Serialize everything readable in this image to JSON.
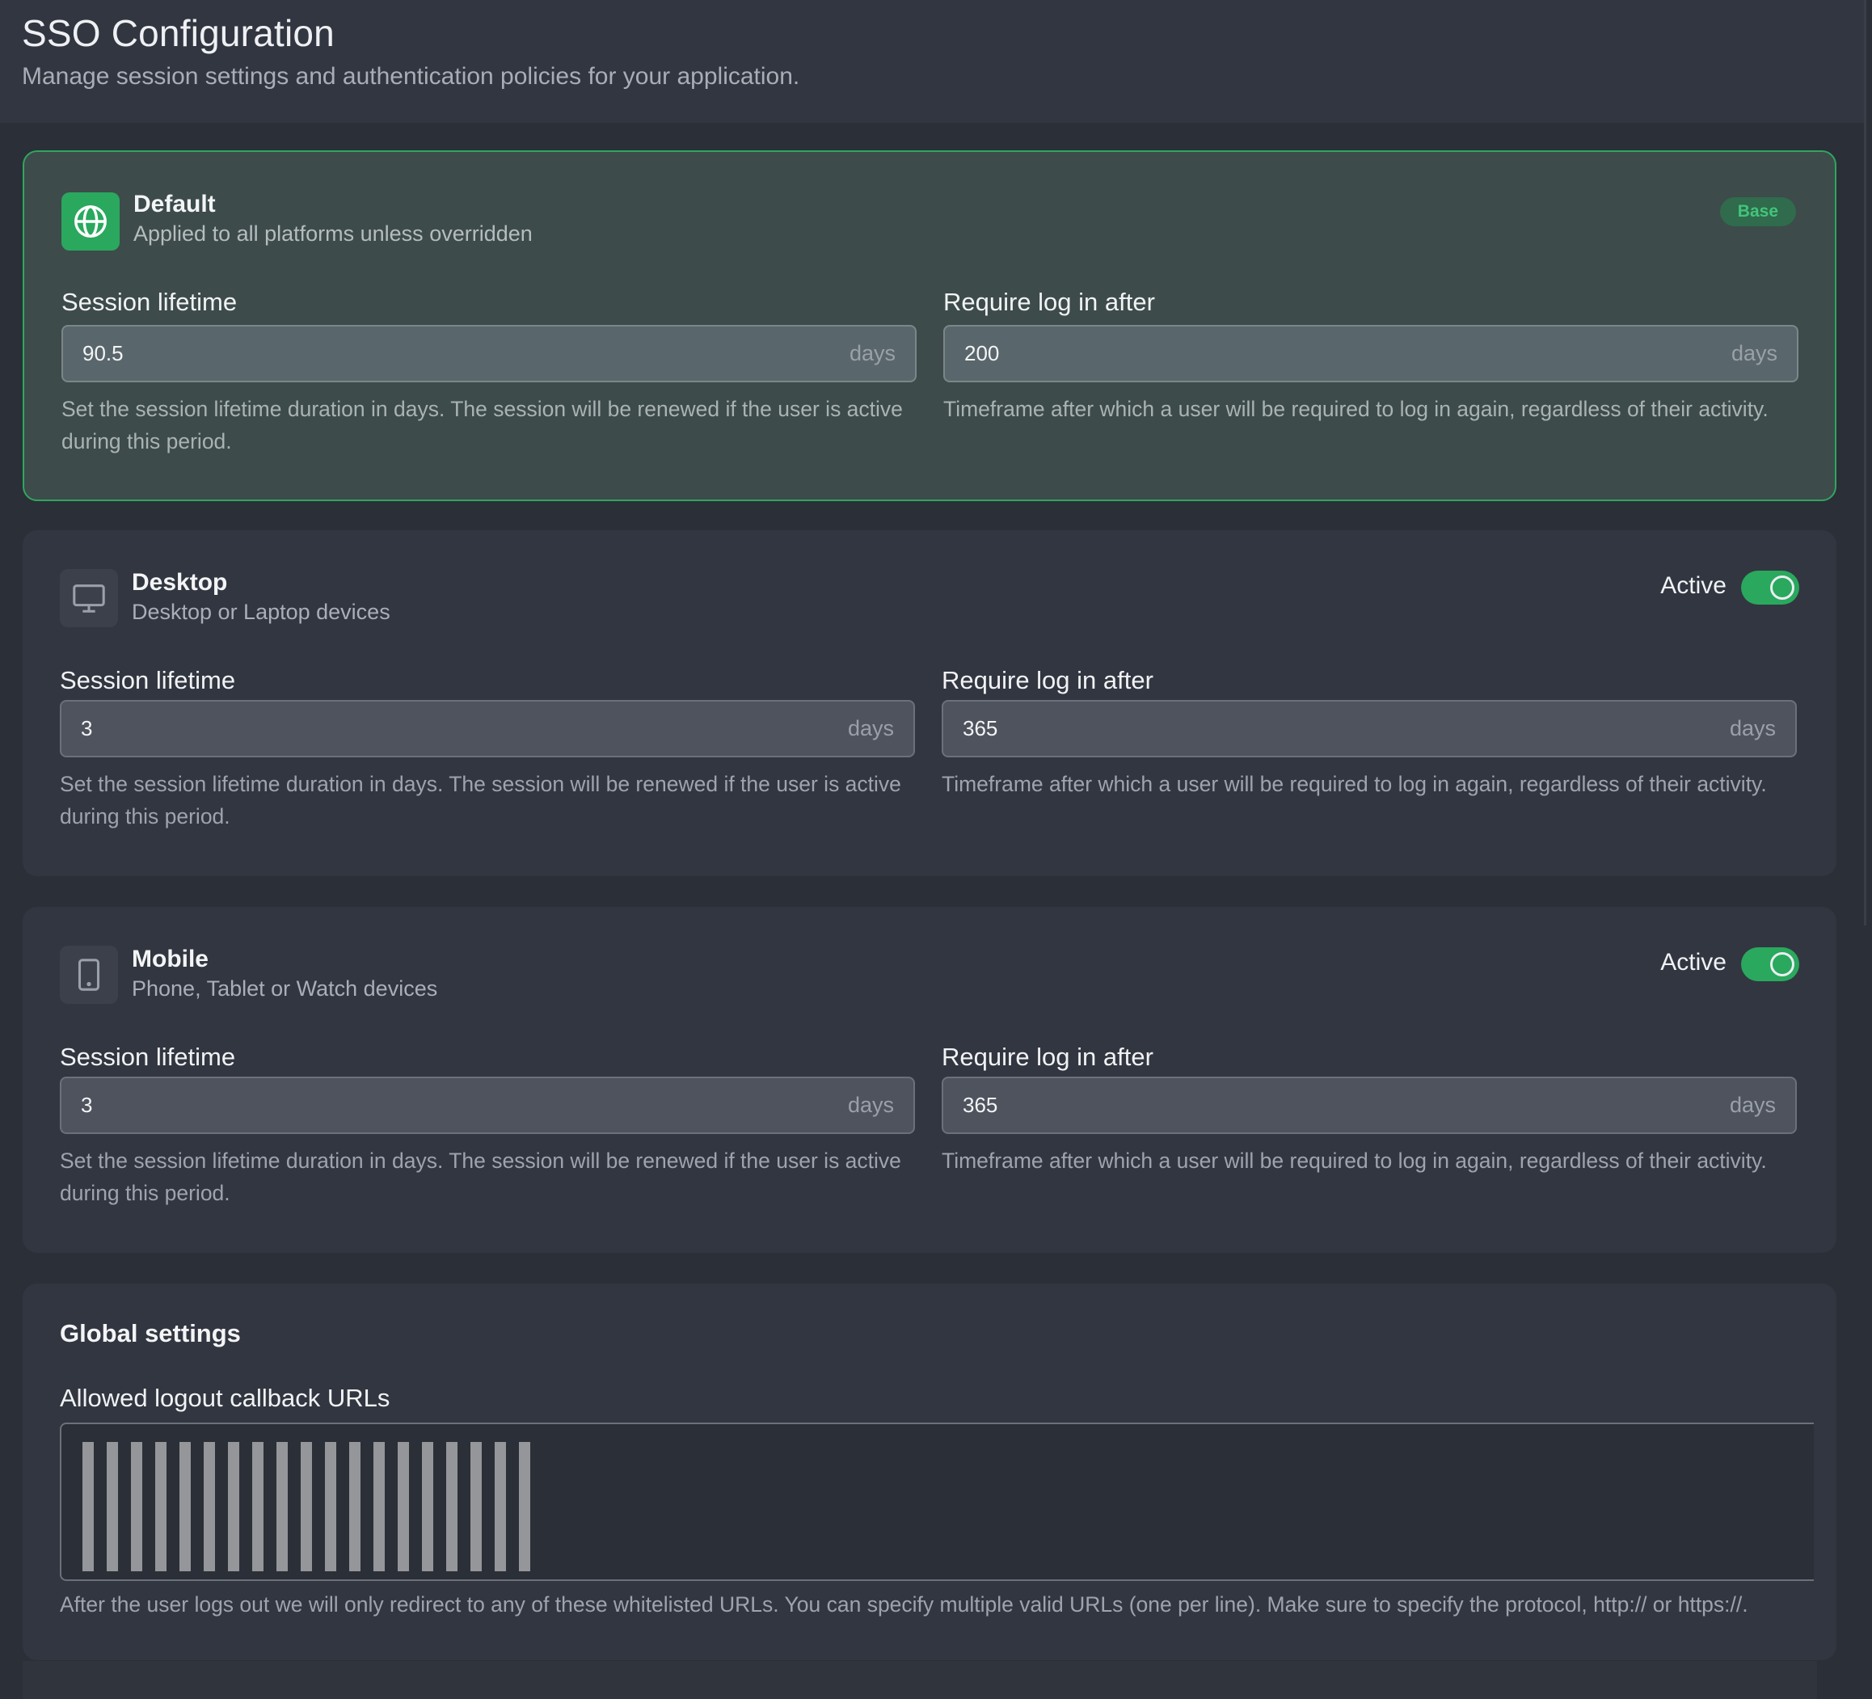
{
  "header": {
    "title": "SSO Configuration",
    "subtitle": "Manage session settings and authentication policies for your application."
  },
  "colors": {
    "accent": "#2aa85e",
    "default_border": "#2fa65f"
  },
  "platforms": {
    "default": {
      "name": "Default",
      "description": "Applied to all platforms unless overridden",
      "badge": "Base",
      "icon": "globe-icon",
      "session_label": "Session lifetime",
      "session_value": "90.5",
      "session_unit": "days",
      "session_help": "Set the session lifetime duration in days. The session will be renewed if the user is active during this period.",
      "login_label": "Require log in after",
      "login_value": "200",
      "login_unit": "days",
      "login_help": "Timeframe after which a user will be required to log in again, regardless of their activity."
    },
    "desktop": {
      "name": "Desktop",
      "description": "Desktop or Laptop devices",
      "icon": "monitor-icon",
      "status_label": "Active",
      "active": true,
      "session_label": "Session lifetime",
      "session_value": "3",
      "session_unit": "days",
      "session_help": "Set the session lifetime duration in days. The session will be renewed if the user is active during this period.",
      "login_label": "Require log in after",
      "login_value": "365",
      "login_unit": "days",
      "login_help": "Timeframe after which a user will be required to log in again, regardless of their activity."
    },
    "mobile": {
      "name": "Mobile",
      "description": "Phone, Tablet or Watch devices",
      "icon": "mobile-icon",
      "status_label": "Active",
      "active": true,
      "session_label": "Session lifetime",
      "session_value": "3",
      "session_unit": "days",
      "session_help": "Set the session lifetime duration in days. The session will be renewed if the user is active during this period.",
      "login_label": "Require log in after",
      "login_value": "365",
      "login_unit": "days",
      "login_help": "Timeframe after which a user will be required to log in again, regardless of their activity."
    }
  },
  "global": {
    "title": "Global settings",
    "urls_label": "Allowed logout callback URLs",
    "urls_help": "After the user logs out we will only redirect to any of these whitelisted URLs. You can specify multiple valid URLs (one per line). Make sure to specify the protocol, http:// or https://."
  }
}
